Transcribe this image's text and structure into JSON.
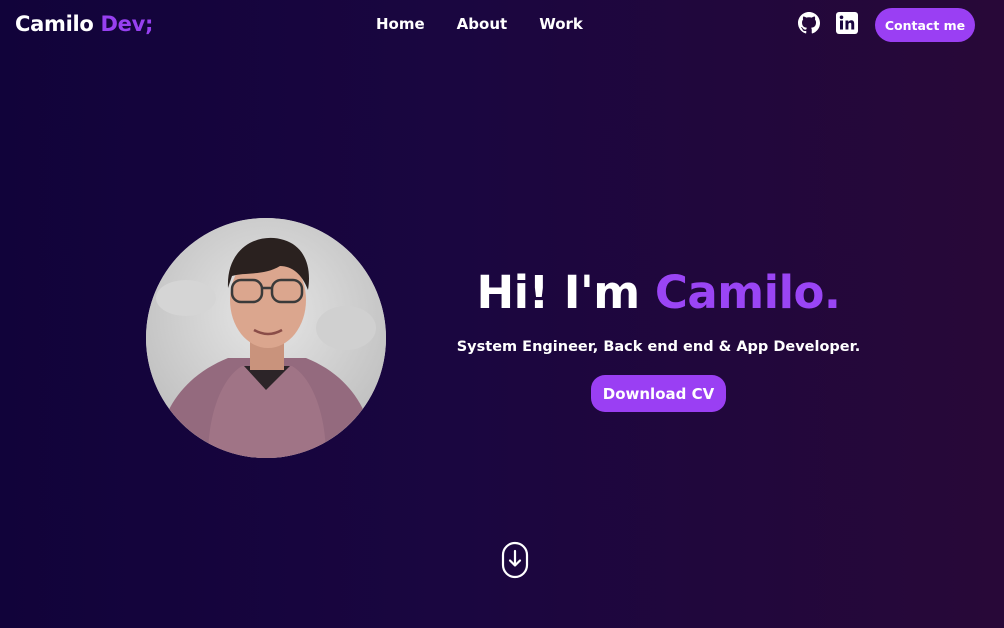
{
  "header": {
    "logo_main": "Camilo",
    "logo_accent": "Dev;",
    "nav": [
      {
        "label": "Home"
      },
      {
        "label": "About"
      },
      {
        "label": "Work"
      }
    ],
    "social_icons": [
      "github-icon",
      "linkedin-icon"
    ],
    "contact_label": "Contact me"
  },
  "hero": {
    "greeting": "Hi! I'm",
    "name": "Camilo.",
    "subtitle": "System Engineer, Back end end & App Developer.",
    "cta_label": "Download CV",
    "scroll_icon": "mouse-scroll-down-icon"
  },
  "colors": {
    "accent": "#9a3ff3",
    "background_start": "#11033a",
    "background_end": "#280838",
    "text": "#ffffff"
  }
}
